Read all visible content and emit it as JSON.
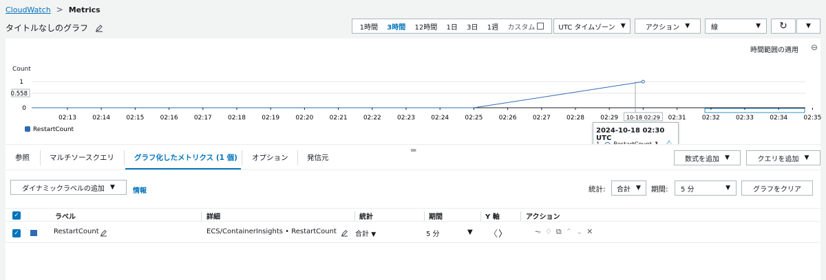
{
  "breadcrumb": {
    "root": "CloudWatch",
    "current": "Metrics"
  },
  "page_title": "タイトルなしのグラフ",
  "time_range": {
    "options": [
      "1時間",
      "3時間",
      "12時間",
      "1日",
      "3日",
      "1週"
    ],
    "active": "3時間",
    "custom": "カスタム"
  },
  "toolbar": {
    "timezone": "UTC タイムゾーン",
    "actions": "アクション",
    "chart_type": "線"
  },
  "chart": {
    "apply_time_range": "時間範囲の適用",
    "y_title": "Count",
    "y_ticks": [
      "1",
      "0.558",
      "0"
    ],
    "x_ticks": [
      "02:13",
      "02:14",
      "02:15",
      "02:16",
      "02:17",
      "02:18",
      "02:19",
      "02:20",
      "02:21",
      "02:22",
      "02:23",
      "02:24",
      "02:25",
      "02:26",
      "02:27",
      "02:28",
      "02:29",
      "10-18 02:29",
      "02:31",
      "02:32",
      "02:33",
      "02:34",
      "02:35"
    ],
    "legend_label": "RestartCount",
    "series_color": "#2e6bb5"
  },
  "chart_data": {
    "type": "line",
    "ylabel": "Count",
    "ylim": [
      0,
      1
    ],
    "series": [
      {
        "name": "RestartCount",
        "x": [
          "02:13",
          "02:25",
          "02:30"
        ],
        "values": [
          0,
          0,
          1
        ]
      }
    ]
  },
  "tooltip": {
    "title": "2024-10-18 02:30 UTC",
    "index": "1.",
    "metric": "RestartCount",
    "value": "1"
  },
  "tabs": [
    "参照",
    "マルチソースクエリ",
    "グラフ化したメトリクス (1 個)",
    "オプション",
    "発信元"
  ],
  "active_tab": "グラフ化したメトリクス (1 個)",
  "buttons": {
    "add_math": "数式を追加",
    "add_query": "クエリを追加",
    "dynamic_label": "ダイナミックラベルの追加",
    "info": "情報",
    "clear_graph": "グラフをクリア"
  },
  "stat_controls": {
    "stat_label": "統計:",
    "stat_value": "合計",
    "period_label": "期間:",
    "period_value": "5 分"
  },
  "table": {
    "headers": [
      "ラベル",
      "詳細",
      "統計",
      "期間",
      "Y 軸",
      "アクション"
    ],
    "rows": [
      {
        "label": "RestartCount",
        "detail": "ECS/ContainerInsights • RestartCount • Se",
        "stat": "合計",
        "period": "5 分",
        "y_axis_left": "〈",
        "y_axis_right": "〉"
      }
    ]
  }
}
